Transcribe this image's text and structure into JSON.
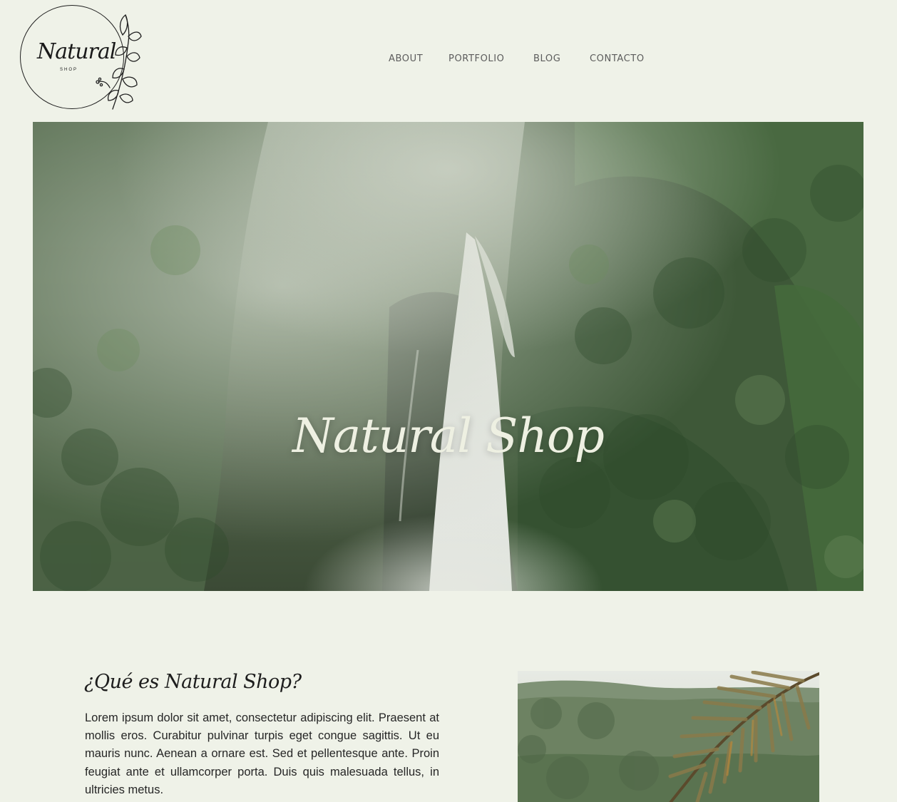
{
  "logo": {
    "word": "Natural",
    "sub": "SHOP"
  },
  "nav": {
    "items": [
      {
        "label": "ABOUT"
      },
      {
        "label": "PORTFOLIO"
      },
      {
        "label": "BLOG"
      },
      {
        "label": "CONTACTO"
      }
    ]
  },
  "hero": {
    "title": "Natural Shop"
  },
  "about": {
    "title": "¿Qué es Natural Shop?",
    "text": "Lorem ipsum dolor sit amet, consectetur adipiscing elit. Praesent at mollis eros. Curabitur pulvinar turpis eget congue sagittis. Ut eu mauris nunc. Aenean a ornare est. Sed et pellentesque ante. Proin feugiat ante et ullamcorper porta. Duis quis malesuada tellus, in ultricies metus."
  },
  "colors": {
    "background": "#eff2e8",
    "nav_text": "#5c5c5c",
    "hero_title": "#eef0e2",
    "body_text": "#262626"
  }
}
